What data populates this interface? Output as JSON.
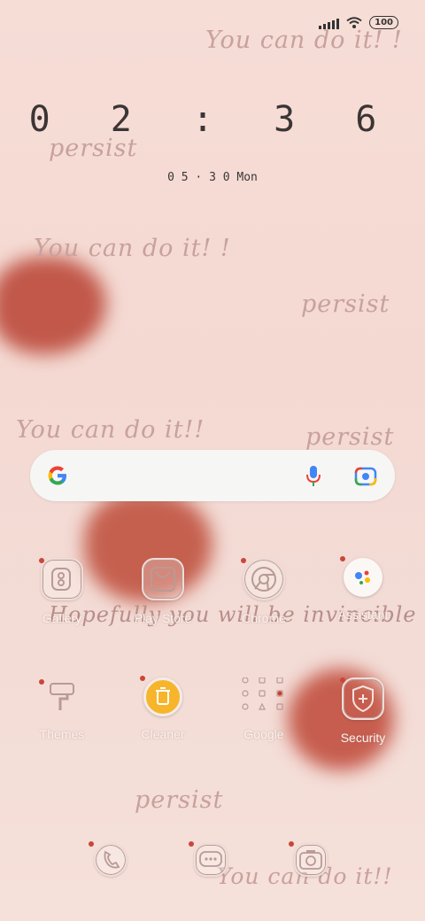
{
  "status_bar": {
    "battery": "100"
  },
  "clock": {
    "time": "0 2 : 3 6",
    "date": "0 5 · 3 0   Mon"
  },
  "wallpaper": {
    "texts": [
      "You can do it! !",
      "persist",
      "You can do it! !",
      "persist",
      "You can do it!!",
      "persist",
      "Hopefully you will be invincible",
      "persist",
      "You can do it!!"
    ],
    "heart_color": "#c1584a"
  },
  "search_bar": {
    "logo": "G",
    "mic_icon": "mic-icon",
    "lens_icon": "lens-icon"
  },
  "apps_row1": [
    {
      "label": "Gallery"
    },
    {
      "label": "Play Store"
    },
    {
      "label": "Chrome"
    },
    {
      "label": "Assistant"
    }
  ],
  "apps_row2": [
    {
      "label": "Themes"
    },
    {
      "label": "Cleaner"
    },
    {
      "label": "Google"
    },
    {
      "label": "Security"
    }
  ],
  "dock": [
    {
      "icon": "phone-icon"
    },
    {
      "icon": "messages-icon"
    },
    {
      "icon": "camera-icon"
    }
  ],
  "colors": {
    "accent_dot": "#c9463b",
    "label_text": "#fbf2ef"
  }
}
